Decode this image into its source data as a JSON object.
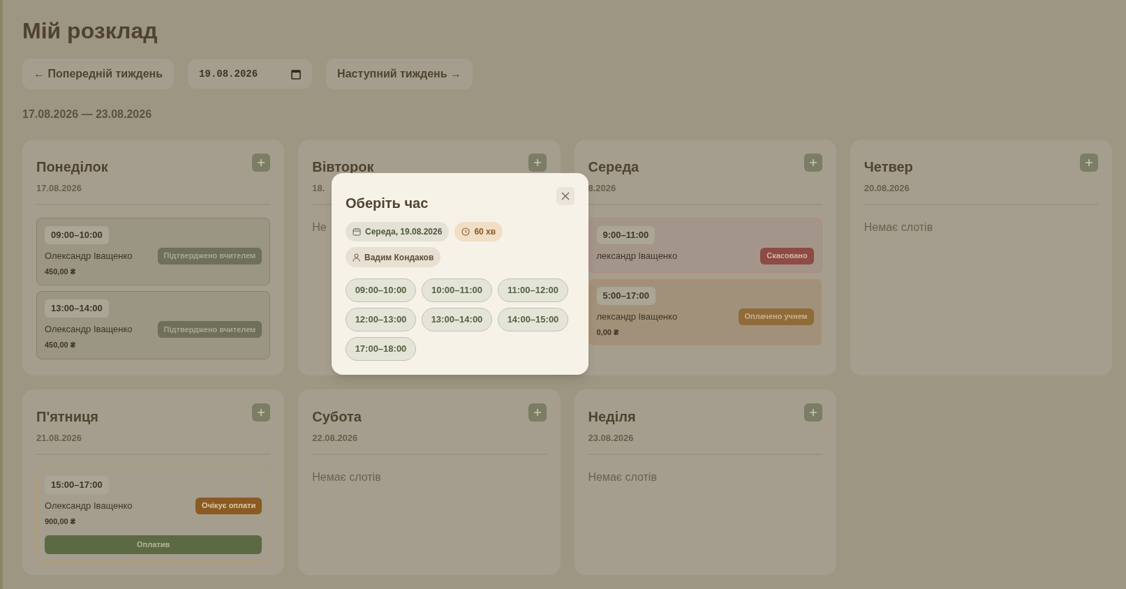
{
  "page": {
    "title": "Мій розклад"
  },
  "nav": {
    "prev": "← Попередній тиждень",
    "date_value": "19.08.2026",
    "next": "Наступний тиждень →"
  },
  "range": "17.08.2026 — 23.08.2026",
  "days": [
    {
      "name": "Понеділок",
      "date": "17.08.2026",
      "slots": [
        {
          "time": "09:00–10:00",
          "student": "Олександр Іващенко",
          "status": "Підтверджено вчителем",
          "kind": "confirmed",
          "price": "450,00 ₴"
        },
        {
          "time": "13:00–14:00",
          "student": "Олександр Іващенко",
          "status": "Підтверджено вчителем",
          "kind": "confirmed",
          "price": "450,00 ₴"
        }
      ]
    },
    {
      "name": "Вівторок",
      "date": "18.",
      "empty": "Не"
    },
    {
      "name": "Середа",
      "date": "8.2026",
      "slots": [
        {
          "time": "9:00–11:00",
          "student": "лександр Іващенко",
          "status": "Скасовано",
          "kind": "cancelled"
        },
        {
          "time": "5:00–17:00",
          "student": "лександр Іващенко",
          "status": "Оплачено учнем",
          "kind": "paid",
          "price": "0,00 ₴"
        }
      ]
    },
    {
      "name": "Четвер",
      "date": "20.08.2026",
      "empty": "Немає слотів"
    },
    {
      "name": "П'ятниця",
      "date": "21.08.2026",
      "slots": [
        {
          "time": "15:00–17:00",
          "student": "Олександр Іващенко",
          "status": "Очікує оплати",
          "kind": "pending",
          "price": "900,00 ₴",
          "action": "Оплатив"
        }
      ]
    },
    {
      "name": "Субота",
      "date": "22.08.2026",
      "empty": "Немає слотів"
    },
    {
      "name": "Неділя",
      "date": "23.08.2026",
      "empty": "Немає слотів"
    }
  ],
  "modal": {
    "title": "Оберіть час",
    "date_chip": "Середа, 19.08.2026",
    "duration_chip": "60 хв",
    "teacher_chip": "Вадим Кондаков",
    "times": [
      "09:00–10:00",
      "10:00–11:00",
      "11:00–12:00",
      "12:00–13:00",
      "13:00–14:00",
      "14:00–15:00",
      "17:00–18:00"
    ]
  }
}
